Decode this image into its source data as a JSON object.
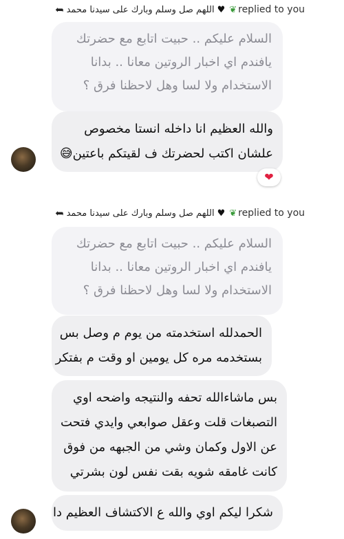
{
  "thread": [
    {
      "reply_header": {
        "sender": "اللهم صل وسلم وبارك على سيدنا محمد",
        "replied_text": "replied to you"
      },
      "quoted_lines": [
        "السلام عليكم .. حبيت اتابع مع حضرتك",
        "يافندم اي اخبار الروتين معانا .. بدانا",
        "الاستخدام ولا لسا وهل لاحظنا فرق ؟"
      ],
      "reply_lines": [
        "والله العظيم انا داخله انستا مخصوص",
        "علشان اكتب لحضرتك ف لقيتكم باعتين😅"
      ],
      "reaction": "❤"
    },
    {
      "reply_header": {
        "sender": "اللهم صل وسلم وبارك على سيدنا محمد",
        "replied_text": "replied to you"
      },
      "quoted_lines": [
        "السلام عليكم .. حبيت اتابع مع حضرتك",
        "يافندم اي اخبار الروتين معانا .. بدانا",
        "الاستخدام ولا لسا وهل لاحظنا فرق ؟"
      ],
      "messages": [
        {
          "lines": [
            "الحمدلله استخدمته من يوم م وصل بس",
            "بستخدمه مره كل يومين او وقت م بفتكر"
          ]
        },
        {
          "lines": [
            "بس ماشاءالله تحفه والنتيجه واضحه اوي",
            "التصبغات قلت وعقل صوابعي وايدي فتحت",
            "عن الاول وكمان وشي من الجبهه من فوق",
            "كانت غامقه شويه بقت نفس لون بشرتي"
          ]
        },
        {
          "lines": [
            "شكرا ليكم اوي والله ع الاكتشاف العظيم دا"
          ]
        }
      ]
    }
  ]
}
